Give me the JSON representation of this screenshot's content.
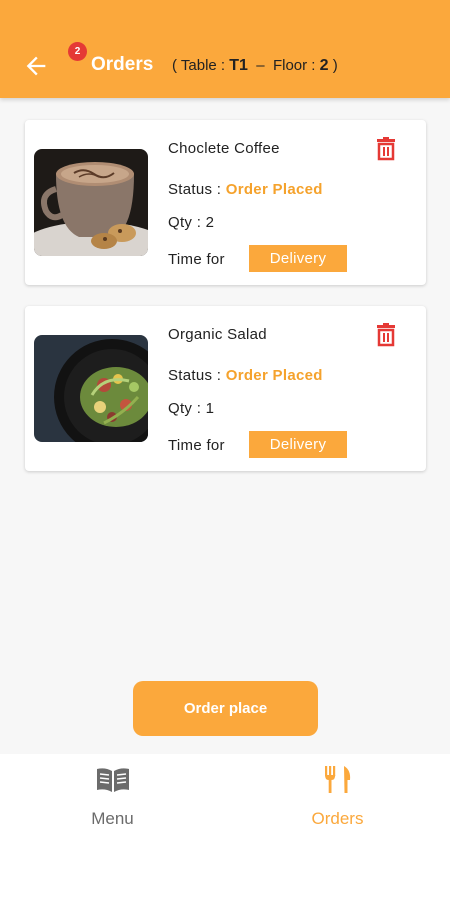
{
  "header": {
    "title": "Orders",
    "badge_count": "2",
    "table_label": "( Table :",
    "table_value": "T1",
    "separator": "–",
    "floor_label": "Floor :",
    "floor_value": "2",
    "closing": ")"
  },
  "orders": [
    {
      "name": "Choclete Coffee",
      "status_label": "Status :",
      "status_value": "Order Placed",
      "qty": "Qty : 2",
      "time_label": "Time for",
      "time_value": "Delivery"
    },
    {
      "name": "Organic Salad",
      "status_label": "Status :",
      "status_value": "Order Placed",
      "qty": "Qty : 1",
      "time_label": "Time for",
      "time_value": "Delivery"
    }
  ],
  "actions": {
    "order_place": "Order place"
  },
  "bottom_nav": {
    "menu_label": "Menu",
    "orders_label": "Orders"
  },
  "colors": {
    "accent": "#fba83c",
    "status": "#f5a22c",
    "delete": "#e53935"
  },
  "icons": {
    "back": "arrow-left-icon",
    "delete": "trash-icon",
    "menu": "book-icon",
    "orders": "fork-knife-icon"
  }
}
